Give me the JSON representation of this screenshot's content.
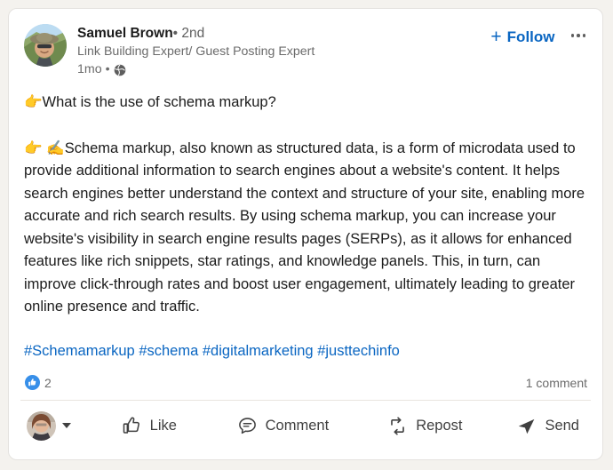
{
  "post": {
    "author": {
      "name": "Samuel Brown",
      "separator": "•",
      "degree": "2nd",
      "headline": "Link Building Expert/ Guest Posting Expert",
      "avatar_name": "author-profile-photo"
    },
    "meta": {
      "time": "1mo",
      "separator": "•",
      "visibility_icon": "globe-icon"
    },
    "header_actions": {
      "follow_label": "Follow",
      "follow_plus": "+",
      "more_label": "more-options"
    },
    "content": {
      "line1_emoji": "👉",
      "line1_text": "What is the use of schema markup?",
      "para_emoji_point": "👉",
      "para_emoji_write": "✍️",
      "para_text": "Schema markup, also known as structured data, is a form of microdata used to provide additional information to search engines about a website's content. It helps search engines better understand the context and structure of your site, enabling more accurate and rich search results. By using schema markup, you can increase your website's visibility in search engine results pages (SERPs), as it allows for enhanced features like rich snippets, star ratings, and knowledge panels. This, in turn, can improve click-through rates and boost user engagement, ultimately leading to greater online presence and traffic."
    },
    "hashtags": [
      "#Schemamarkup",
      "#schema",
      "#digitalmarketing",
      "#justtechinfo"
    ],
    "social": {
      "reaction_icon": "like-thumbs-up-icon",
      "reaction_count": "2",
      "comment_count": "1 comment"
    },
    "actions": {
      "commenter_avatar_name": "current-user-avatar",
      "like_label": "Like",
      "comment_label": "Comment",
      "repost_label": "Repost",
      "send_label": "Send"
    }
  },
  "colors": {
    "brand_blue": "#0a66c2",
    "reaction_blue": "#378fe9",
    "text_primary": "#1b1b1b",
    "text_secondary": "#6b6b6b",
    "card_bg": "#ffffff",
    "page_bg": "#f4f2ee"
  }
}
